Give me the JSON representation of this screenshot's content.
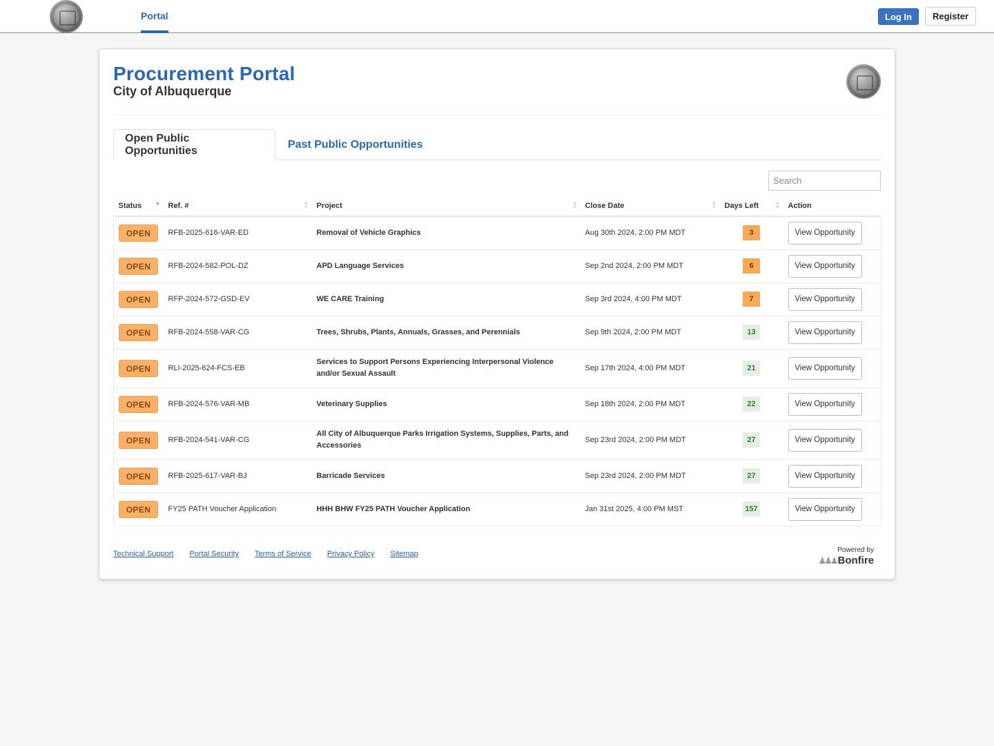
{
  "nav": {
    "portal_label": "Portal",
    "login_label": "Log In",
    "register_label": "Register"
  },
  "header": {
    "title": "Procurement Portal",
    "subtitle": "City of Albuquerque"
  },
  "tabs": [
    {
      "label": "Open Public Opportunities",
      "active": true
    },
    {
      "label": "Past Public Opportunities",
      "active": false
    }
  ],
  "search": {
    "placeholder": "Search",
    "value": ""
  },
  "table": {
    "columns": [
      "Status",
      "Ref. #",
      "Project",
      "Close Date",
      "Days Left",
      "Action"
    ],
    "sort": {
      "column": "Status",
      "direction": "ascending"
    },
    "rows": [
      {
        "status": "OPEN",
        "ref": "RFB-2025-616-VAR-ED",
        "project": "Removal of Vehicle Graphics",
        "close_date": "Aug 30th 2024, 2:00 PM MDT",
        "days_left": "3",
        "urgency": "urgent",
        "action": "View Opportunity"
      },
      {
        "status": "OPEN",
        "ref": "RFB-2024-582-POL-DZ",
        "project": "APD Language Services",
        "close_date": "Sep 2nd 2024, 2:00 PM MDT",
        "days_left": "6",
        "urgency": "urgent",
        "action": "View Opportunity"
      },
      {
        "status": "OPEN",
        "ref": "RFP-2024-572-GSD-EV",
        "project": "WE CARE Training",
        "close_date": "Sep 3rd 2024, 4:00 PM MDT",
        "days_left": "7",
        "urgency": "urgent",
        "action": "View Opportunity"
      },
      {
        "status": "OPEN",
        "ref": "RFB-2024-558-VAR-CG",
        "project": "Trees, Shrubs, Plants, Annuals, Grasses, and Perennials",
        "close_date": "Sep 9th 2024, 2:00 PM MDT",
        "days_left": "13",
        "urgency": "ok",
        "action": "View Opportunity"
      },
      {
        "status": "OPEN",
        "ref": "RLI-2025-624-FCS-EB",
        "project": "Services to Support Persons Experiencing Interpersonal Violence and/or Sexual Assault",
        "close_date": "Sep 17th 2024, 4:00 PM MDT",
        "days_left": "21",
        "urgency": "ok",
        "action": "View Opportunity"
      },
      {
        "status": "OPEN",
        "ref": "RFB-2024-576-VAR-MB",
        "project": "Veterinary Supplies",
        "close_date": "Sep 18th 2024, 2:00 PM MDT",
        "days_left": "22",
        "urgency": "ok",
        "action": "View Opportunity"
      },
      {
        "status": "OPEN",
        "ref": "RFB-2024-541-VAR-CG",
        "project": "All City of Albuquerque Parks Irrigation Systems, Supplies, Parts, and Accessories",
        "close_date": "Sep 23rd 2024, 2:00 PM MDT",
        "days_left": "27",
        "urgency": "ok",
        "action": "View Opportunity"
      },
      {
        "status": "OPEN",
        "ref": "RFB-2025-617-VAR-BJ",
        "project": "Barricade Services",
        "close_date": "Sep 23rd 2024, 2:00 PM MDT",
        "days_left": "27",
        "urgency": "ok",
        "action": "View Opportunity"
      },
      {
        "status": "OPEN",
        "ref": "FY25 PATH Voucher Application",
        "project": "HHH BHW FY25 PATH Voucher Application",
        "close_date": "Jan 31st 2025, 4:00 PM MST",
        "days_left": "157",
        "urgency": "ok",
        "action": "View Opportunity"
      }
    ]
  },
  "footer": {
    "links": [
      "Technical Support",
      "Portal Security",
      "Terms of Service",
      "Privacy Policy",
      "Sitemap"
    ],
    "powered_by": "Powered by",
    "brand": "Bonfire"
  },
  "colors": {
    "brand_blue": "#2a68b0",
    "open_badge": "#f9b16a",
    "urgent_days": "#f8a95a",
    "ok_days": "#e4efe2"
  }
}
